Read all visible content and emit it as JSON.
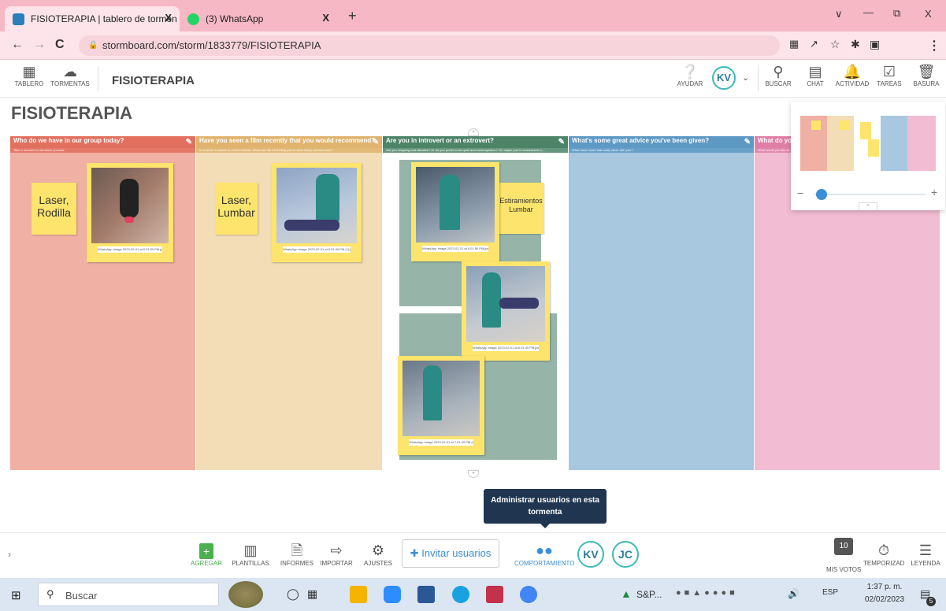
{
  "browser": {
    "tabs": [
      {
        "title": "FISIOTERAPIA | tablero de tormen",
        "close": "X"
      },
      {
        "title": "(3) WhatsApp",
        "close": "X"
      }
    ],
    "new_tab": "+",
    "url": "stormboard.com/storm/1833779/FISIOTERAPIA",
    "window_controls": [
      "∨",
      "—",
      "⧉",
      "X"
    ]
  },
  "header": {
    "left": [
      {
        "label": "TABLERO",
        "icon": "grid-icon"
      },
      {
        "label": "TORMENTAS",
        "icon": "cloud-icon"
      }
    ],
    "title": "FISIOTERAPIA",
    "help_label": "AYUDAR",
    "user_initials": "KV",
    "right": [
      {
        "label": "BUSCAR",
        "icon": "search-icon"
      },
      {
        "label": "CHAT",
        "icon": "chat-icon"
      },
      {
        "label": "ACTIVIDAD",
        "icon": "bell-icon"
      },
      {
        "label": "TAREAS",
        "icon": "tasks-icon"
      },
      {
        "label": "BASURA",
        "icon": "trash-icon"
      }
    ]
  },
  "board": {
    "title": "FISIOTERAPIA",
    "columns": [
      {
        "title": "Who do we have in our group today?",
        "subtitle": "Take a moment to introduce yourself",
        "color": "#e2705e",
        "bg": "#f0b0a4"
      },
      {
        "title": "Have you seen a film recently that you would recommend?",
        "subtitle": "It could be a classic or a new release. What can the best thing you've seen lately, cinema-wise?",
        "color": "#e0b46e",
        "bg": "#f3ddb6"
      },
      {
        "title": "Are you in introvert or an extrovert?",
        "subtitle": "Are you outgoing and talkative? Or do you prefer to be quiet and contemplative? Or maybe you're somewhere in...",
        "color": "#4d8468",
        "bg": "#ffffff"
      },
      {
        "title": "What's some great advice you've been given?",
        "subtitle": "What have heard that really stuck with you?",
        "color": "#5e99c4",
        "bg": "#a7c8df"
      },
      {
        "title": "What do you",
        "subtitle": "What would you like to",
        "color": "#e07fa6",
        "bg": "#f2bcd2"
      }
    ],
    "notes": [
      {
        "text": "Laser, Rodilla"
      },
      {
        "text": "Laser, Lumbar"
      },
      {
        "text": "Estiramientos Lumbar"
      }
    ],
    "photo_captions": [
      "WhatsApp Image 2023-02-01 at 6.01.50 PM.jpeg",
      "WhatsApp Image 2023-02-01 at 6.01.49 PM (1).jpeg",
      "WhatsApp Image 2023-02-01 at 6.01.50 PM.jpeg",
      "WhatsApp Image 2023-02-01 at 6.01.49 PM.jpeg",
      "WhatsApp Image 2023-02-01 at 7.01.49 PM (2).jpeg"
    ],
    "partial_text": "rt"
  },
  "minimap": {
    "zoom_minus": "−",
    "zoom_plus": "+"
  },
  "tooltip": "Administrar usuarios en esta tormenta",
  "toolbar": {
    "items": [
      {
        "label": "AGREGAR",
        "icon": "add-icon"
      },
      {
        "label": "PLANTILLAS",
        "icon": "templates-icon"
      },
      {
        "label": "INFORMES",
        "icon": "reports-icon"
      },
      {
        "label": "IMPORTAR",
        "icon": "import-icon"
      },
      {
        "label": "AJUSTES",
        "icon": "settings-icon"
      }
    ],
    "invite_label": "Invitar usuarios",
    "behaviour_label": "COMPORTAMIENTO",
    "users": [
      "KV",
      "JC"
    ],
    "votes_count": "10",
    "votes_label": "MIS VOTOS",
    "timer_label": "TEMPORIZAD",
    "legend_label": "LEYENDA"
  },
  "taskbar": {
    "search_placeholder": "Buscar",
    "stock_label": "S&P...",
    "language": "ESP",
    "time": "1:37 p. m.",
    "date": "02/02/2023",
    "notifications": "5"
  }
}
